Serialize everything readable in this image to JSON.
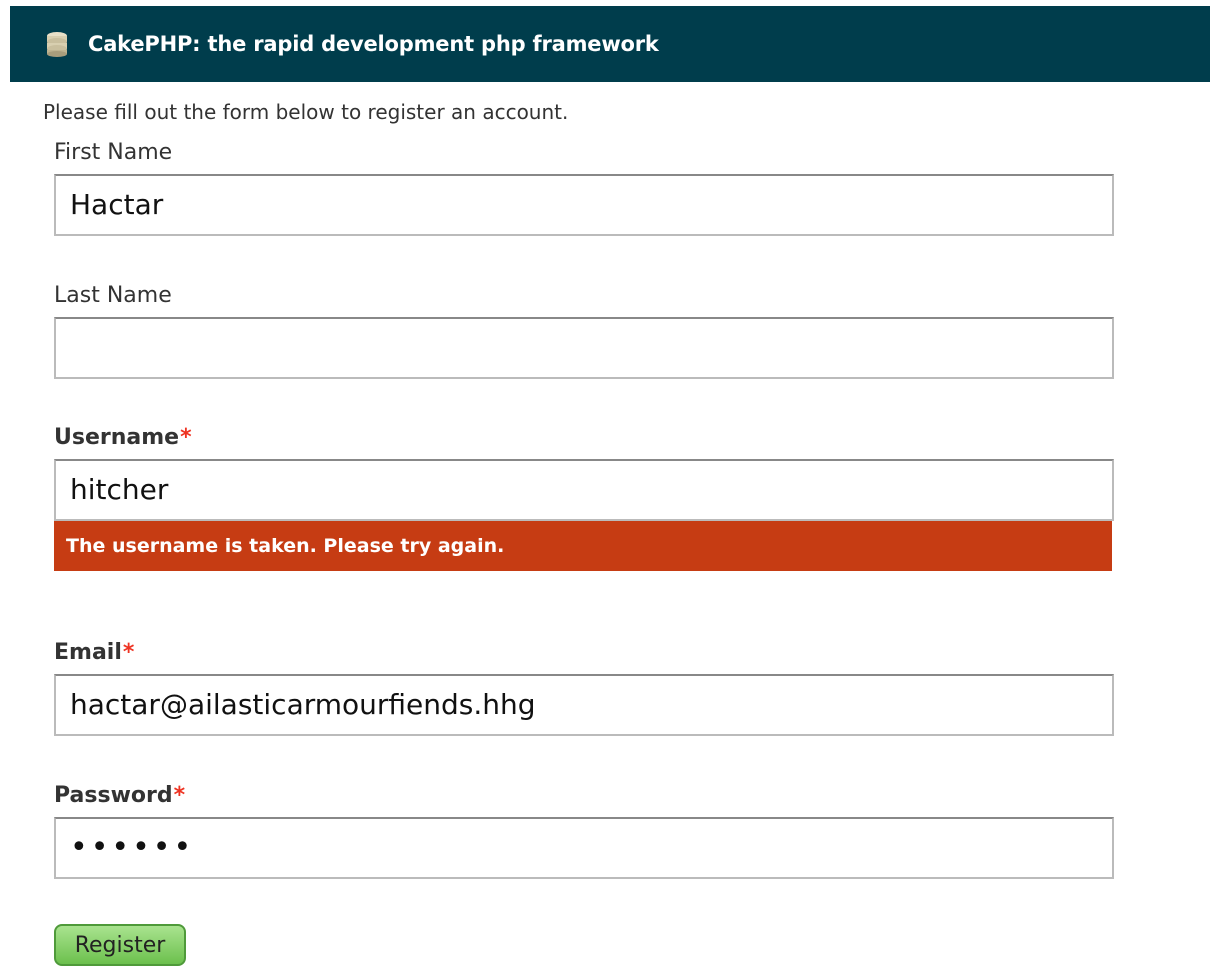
{
  "header": {
    "title": "CakePHP: the rapid development php framework",
    "logo_icon": "cake-icon",
    "background": "#003d4c"
  },
  "intro": "Please fill out the form below to register an account.",
  "fields": {
    "first_name": {
      "label": "First Name",
      "value": "Hactar"
    },
    "last_name": {
      "label": "Last Name",
      "value": ""
    },
    "username": {
      "label": "Username",
      "required_mark": "*",
      "value": "hitcher",
      "error": "The username is taken. Please try again."
    },
    "email": {
      "label": "Email",
      "required_mark": "*",
      "value": "hactar@ailasticarmourfiends.hhg"
    },
    "password": {
      "label": "Password",
      "required_mark": "*",
      "value": "••••••"
    }
  },
  "register_button": "Register",
  "colors": {
    "error_background": "#c63c13",
    "button_green": "#6cc04d",
    "required_star": "#ee3322"
  }
}
